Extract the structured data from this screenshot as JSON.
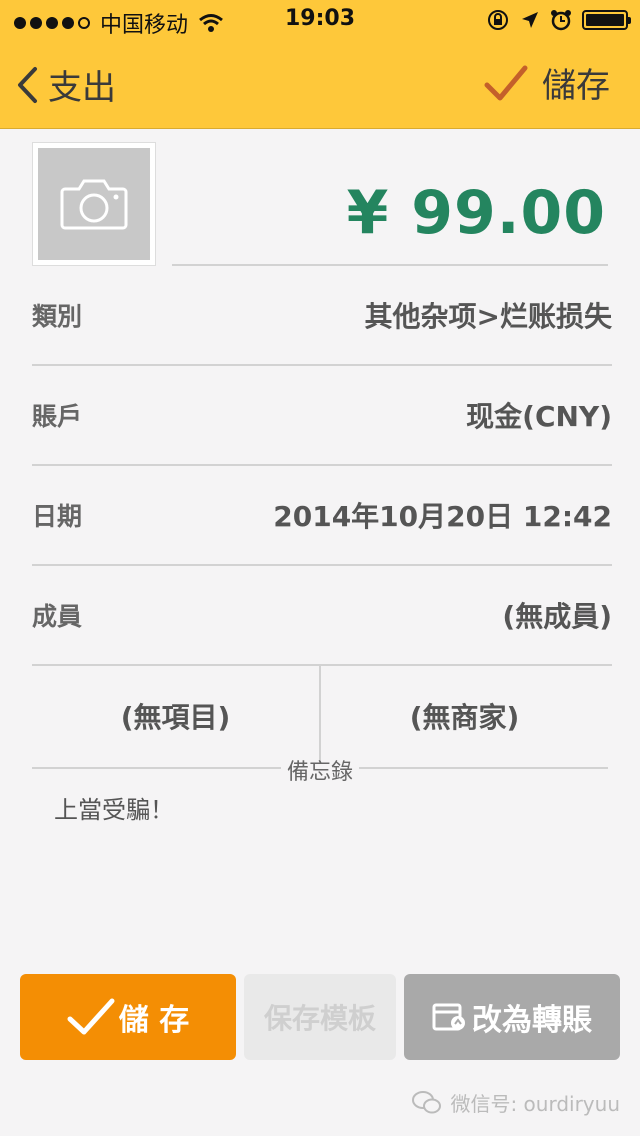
{
  "status_bar": {
    "carrier": "中国移动",
    "time": "19:03"
  },
  "nav": {
    "back_label": "支出",
    "save_label": "儲存"
  },
  "amount": {
    "display": "¥ 99.00",
    "currency_symbol": "¥",
    "value": 99.0,
    "color": "#24855f"
  },
  "fields": {
    "category": {
      "label": "類別",
      "value": "其他杂项>烂账损失"
    },
    "account": {
      "label": "賬戶",
      "value": "现金(CNY)"
    },
    "date": {
      "label": "日期",
      "value": "2014年10月20日 12:42"
    },
    "member": {
      "label": "成員",
      "value": "(無成員)"
    }
  },
  "project": "(無項目)",
  "merchant": "(無商家)",
  "memo": {
    "title": "備忘錄",
    "text": "上當受騙！"
  },
  "buttons": {
    "save": "儲 存",
    "template": "保存模板",
    "transfer": "改為轉賬"
  },
  "watermark": "微信号: ourdiryuu",
  "colors": {
    "nav_bg": "#fec83a",
    "save_button": "#f48e04",
    "transfer_button": "#a9a9a9",
    "amount": "#24855f"
  },
  "icons": [
    "camera-icon",
    "back-chevron-icon",
    "checkmark-icon",
    "wifi-icon",
    "lock-rotation-icon",
    "location-icon",
    "alarm-icon",
    "battery-icon",
    "transfer-icon",
    "wechat-icon"
  ]
}
